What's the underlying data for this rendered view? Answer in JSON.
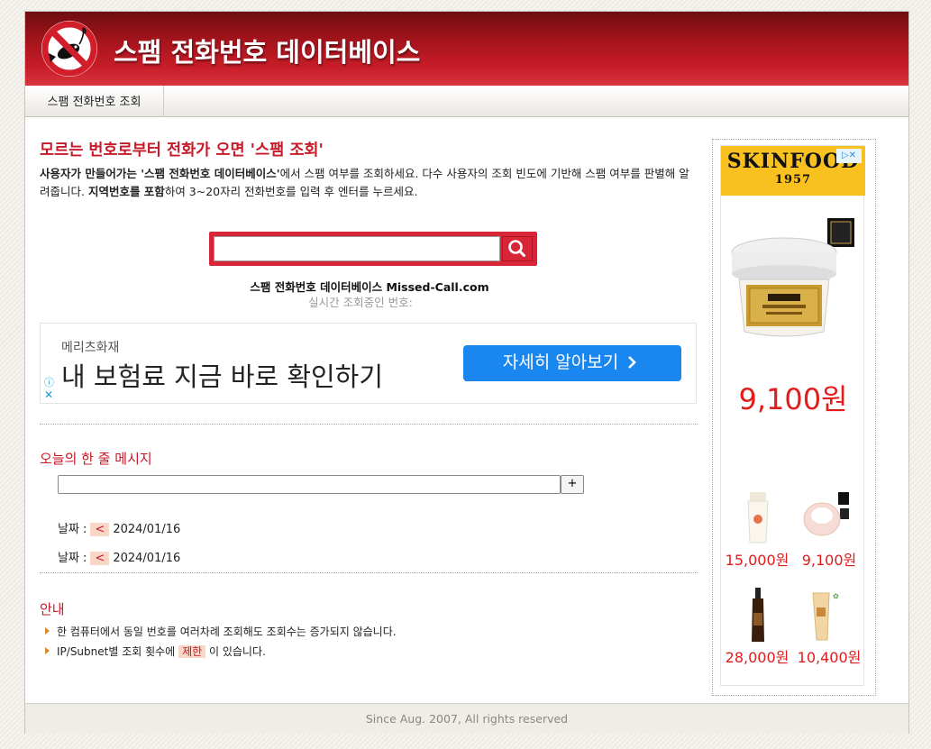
{
  "header": {
    "site_title": "스팸 전화번호 데이터베이스"
  },
  "nav": {
    "tab_label": "스팸 전화번호 조회"
  },
  "intro": {
    "headline": "모르는 번호로부터 전화가 오면 '스팸 조회'",
    "desc_b1": "사용자가 만들어가는 '스팸 전화번호 데이터베이스'",
    "desc_t1": "에서 스팸 여부를 조회하세요. 다수 사용자의 조회 빈도에 기반해 스팸 여부를 판별해 알려줍니다. ",
    "desc_b2": "지역번호를 포함",
    "desc_t2": "하여 3~20자리 전화번호를 입력 후 엔터를 누르세요."
  },
  "search": {
    "value": "",
    "brand_line_prefix": "스팸 전화번호 데이터베이스 ",
    "brand_line_domain": "Missed-Call.com",
    "realtime_label": "실시간 조회중인 번호:"
  },
  "ad_banner": {
    "advertiser": "메리츠화재",
    "headline": "내 보험료 지금 바로 확인하기",
    "cta": "자세히 알아보기",
    "cta_icon": "chevron-right",
    "info_icon": "ⓘ",
    "close_icon": "✕"
  },
  "daily_message": {
    "title": "오늘의 한 줄 메시지",
    "input_value": "",
    "add_label": "+",
    "rows": [
      {
        "label": "날짜 :",
        "prev": "<",
        "date": "2024/01/16"
      },
      {
        "label": "날짜 :",
        "prev": "<",
        "date": "2024/01/16"
      }
    ]
  },
  "notice": {
    "title": "안내",
    "item1": "한 컴퓨터에서 동일 번호를 여러차례 조회해도 조회수는 증가되지 않습니다.",
    "item2_pre": "IP/Subnet별 조회 횟수에",
    "item2_hl": "제한",
    "item2_post": "이 있습니다."
  },
  "side_ad": {
    "brand": "SKINFOOD",
    "year": "1957",
    "main_price": "9,100원",
    "products": [
      {
        "price": "15,000원"
      },
      {
        "price": "9,100원"
      },
      {
        "price": "28,000원"
      },
      {
        "price": "10,400원"
      }
    ]
  },
  "footer": {
    "text": "Since Aug. 2007, All rights reserved"
  },
  "colors": {
    "brand_red": "#c71a28",
    "header_red": "#c81d28",
    "cta_blue": "#1a86f0",
    "price_red": "#e21b1b",
    "skinfood_yellow": "#f8c11f"
  }
}
